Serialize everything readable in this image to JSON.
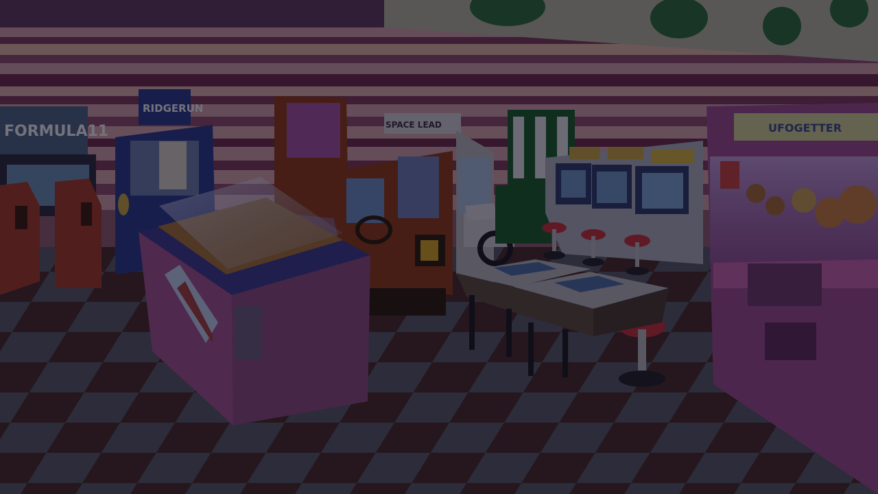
{
  "scene": {
    "signs": {
      "formula_cabinet": "FORMULA11",
      "top_sign": "RIDGERUN",
      "side_cabinet": "SPACE LEAD",
      "crane_game": "UFOGETTER"
    }
  },
  "colors": {
    "wall_stripe_light": "#c89aa6",
    "wall_stripe_dark": "#6a2a4a",
    "floor_light": "#5c6470",
    "floor_dark": "#4a2a22",
    "pink_cabinet": "#a0508e",
    "crane_pink": "#9a4a8e",
    "orange_cabinet": "#8a3a18",
    "blue_cabinet": "#2a3a8a",
    "red_cabinet": "#8a2a1a",
    "white_cabinet": "#a8aab8",
    "overlay_tint": "rgba(8, 6, 20, 0.52)"
  }
}
